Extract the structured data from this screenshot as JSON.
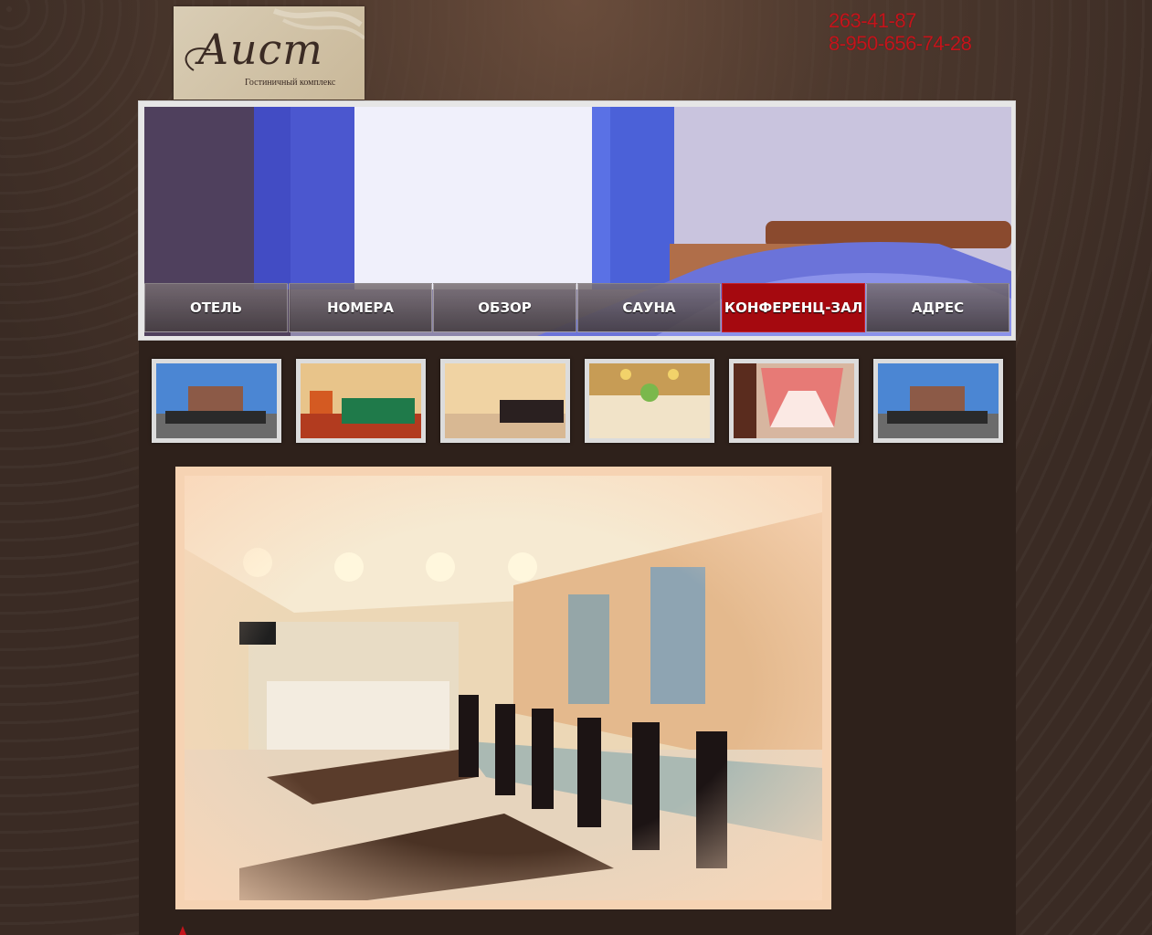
{
  "logo": {
    "script": "Аист",
    "subtitle": "Гостиничный комплекс"
  },
  "phones": [
    "263-41-87",
    "8-950-656-74-28"
  ],
  "nav": {
    "items": [
      "ОТЕЛЬ",
      "НОМЕРА",
      "ОБЗОР",
      "САУНА",
      "КОНФЕРЕНЦ-ЗАЛ",
      "АДРЕС"
    ],
    "active": "КОНФЕРЕНЦ-ЗАЛ"
  },
  "thumbnails": [
    "hotel-exterior-photo",
    "billiard-room-photo",
    "conference-hall-photo",
    "banquet-table-photo",
    "curtained-window-photo",
    "hotel-exterior-photo"
  ],
  "colors": {
    "accent": "#a5090f",
    "phone_text": "#c4141b",
    "background": "#3a2b24"
  }
}
